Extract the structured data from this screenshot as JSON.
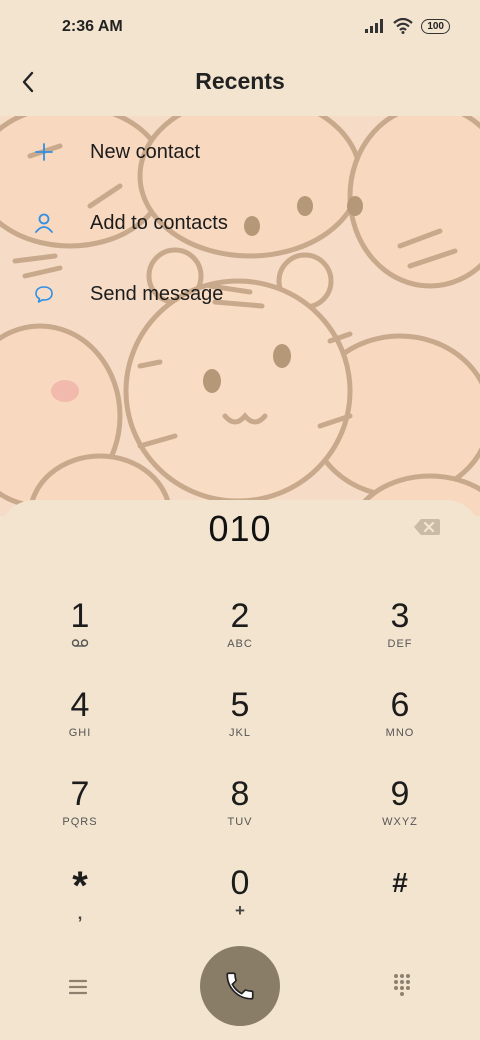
{
  "status": {
    "time": "2:36 AM",
    "battery": "100"
  },
  "header": {
    "title": "Recents"
  },
  "actions": [
    {
      "label": "New contact",
      "icon": "plus-icon"
    },
    {
      "label": "Add to contacts",
      "icon": "person-icon"
    },
    {
      "label": "Send message",
      "icon": "chat-bubble-icon"
    }
  ],
  "dialer": {
    "number": "010",
    "keys": [
      {
        "digit": "1",
        "letters": ""
      },
      {
        "digit": "2",
        "letters": "ABC"
      },
      {
        "digit": "3",
        "letters": "DEF"
      },
      {
        "digit": "4",
        "letters": "GHI"
      },
      {
        "digit": "5",
        "letters": "JKL"
      },
      {
        "digit": "6",
        "letters": "MNO"
      },
      {
        "digit": "7",
        "letters": "PQRS"
      },
      {
        "digit": "8",
        "letters": "TUV"
      },
      {
        "digit": "9",
        "letters": "WXYZ"
      },
      {
        "digit": "*",
        "letters": ","
      },
      {
        "digit": "0",
        "letters": "+"
      },
      {
        "digit": "#",
        "letters": ""
      }
    ]
  },
  "colors": {
    "accent": "#2f8fe6",
    "call": "#8a7d68",
    "background": "#f3e4cf"
  }
}
